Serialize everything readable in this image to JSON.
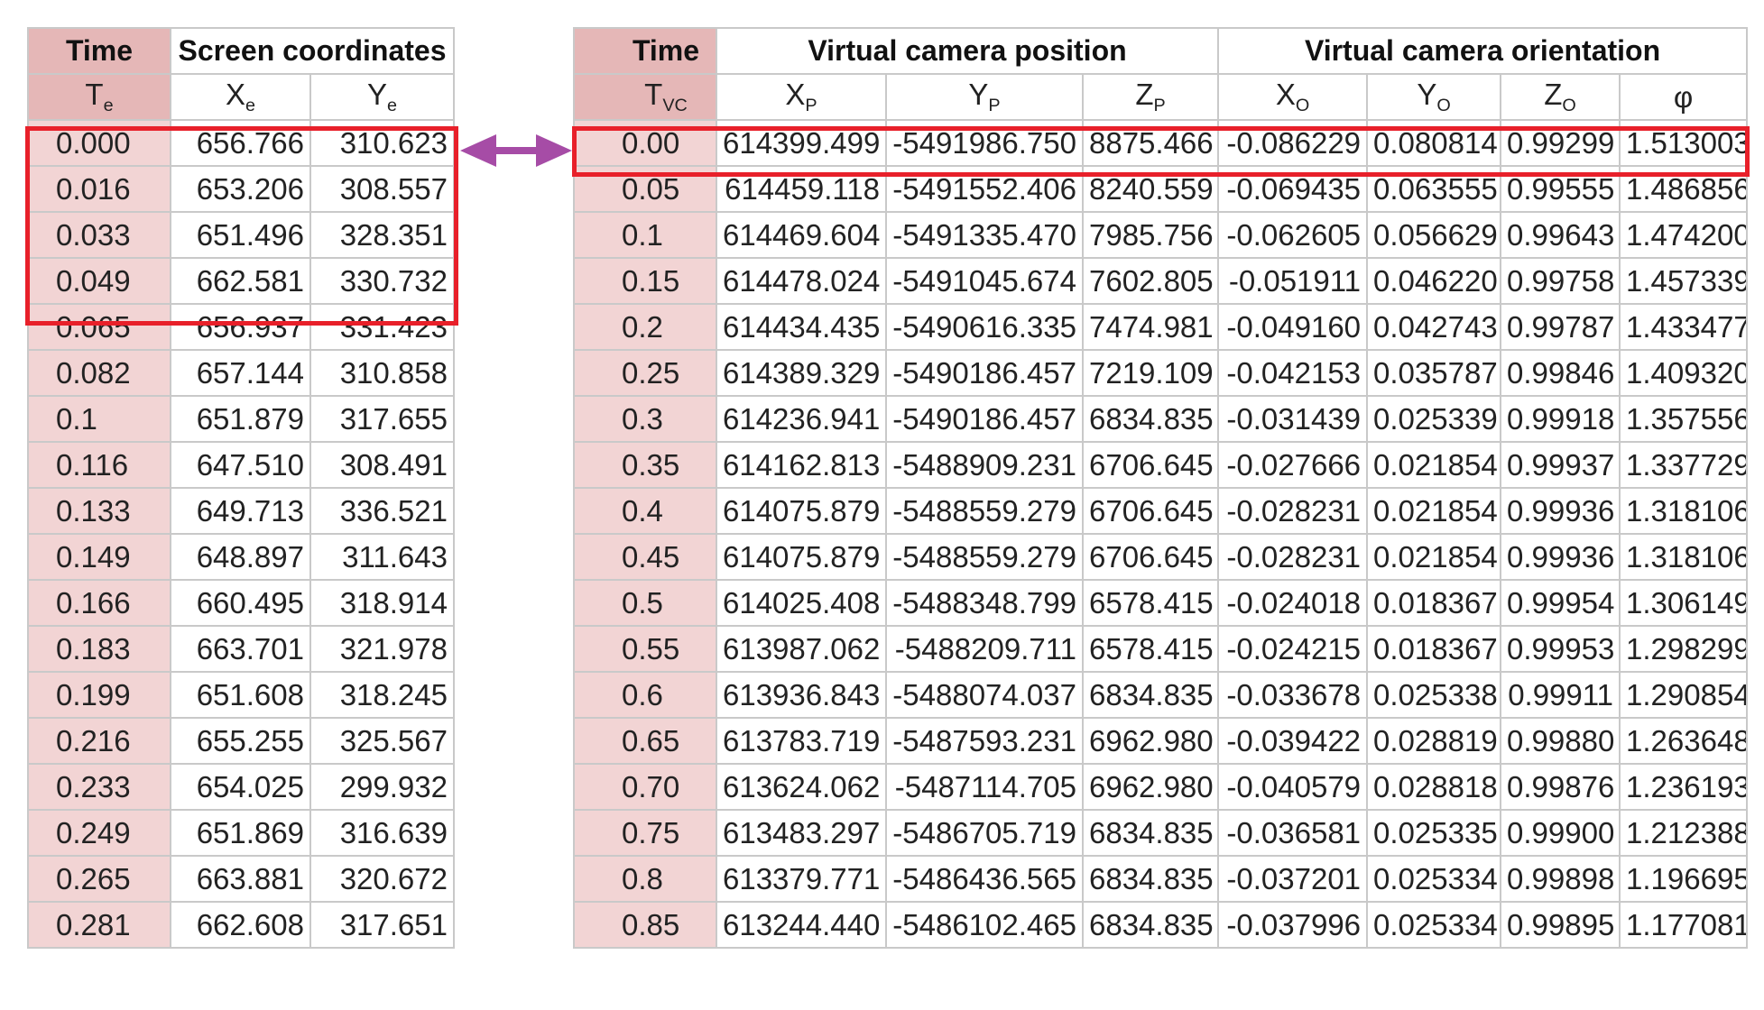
{
  "screen_table": {
    "time_header": "Time",
    "coords_header": "Screen coordinates",
    "time_symbol": "T",
    "time_symbol_sub": "e",
    "x_symbol": "X",
    "x_symbol_sub": "e",
    "y_symbol": "Y",
    "y_symbol_sub": "e",
    "rows": [
      [
        "0.000",
        "656.766",
        "310.623"
      ],
      [
        "0.016",
        "653.206",
        "308.557"
      ],
      [
        "0.033",
        "651.496",
        "328.351"
      ],
      [
        "0.049",
        "662.581",
        "330.732"
      ],
      [
        "0.065",
        "656.937",
        "331.423"
      ],
      [
        "0.082",
        "657.144",
        "310.858"
      ],
      [
        "0.1",
        "651.879",
        "317.655"
      ],
      [
        "0.116",
        "647.510",
        "308.491"
      ],
      [
        "0.133",
        "649.713",
        "336.521"
      ],
      [
        "0.149",
        "648.897",
        "311.643"
      ],
      [
        "0.166",
        "660.495",
        "318.914"
      ],
      [
        "0.183",
        "663.701",
        "321.978"
      ],
      [
        "0.199",
        "651.608",
        "318.245"
      ],
      [
        "0.216",
        "655.255",
        "325.567"
      ],
      [
        "0.233",
        "654.025",
        "299.932"
      ],
      [
        "0.249",
        "651.869",
        "316.639"
      ],
      [
        "0.265",
        "663.881",
        "320.672"
      ],
      [
        "0.281",
        "662.608",
        "317.651"
      ]
    ]
  },
  "camera_table": {
    "time_header": "Time",
    "position_header": "Virtual camera position",
    "orientation_header": "Virtual camera orientation",
    "time_symbol": "T",
    "time_symbol_sub": "VC",
    "xp_symbol": "X",
    "xp_sub": "P",
    "yp_symbol": "Y",
    "yp_sub": "P",
    "zp_symbol": "Z",
    "zp_sub": "P",
    "xo_symbol": "X",
    "xo_sub": "O",
    "yo_symbol": "Y",
    "yo_sub": "O",
    "zo_symbol": "Z",
    "zo_sub": "O",
    "phi_symbol": "φ",
    "rows": [
      [
        "0.00",
        "614399.499",
        "-5491986.750",
        "8875.466",
        "-0.086229",
        "0.080814",
        "0.99299",
        "1.513003"
      ],
      [
        "0.05",
        "614459.118",
        "-5491552.406",
        "8240.559",
        "-0.069435",
        "0.063555",
        "0.99555",
        "1.486856"
      ],
      [
        "0.1",
        "614469.604",
        "-5491335.470",
        "7985.756",
        "-0.062605",
        "0.056629",
        "0.99643",
        "1.474200"
      ],
      [
        "0.15",
        "614478.024",
        "-5491045.674",
        "7602.805",
        "-0.051911",
        "0.046220",
        "0.99758",
        "1.457339"
      ],
      [
        "0.2",
        "614434.435",
        "-5490616.335",
        "7474.981",
        "-0.049160",
        "0.042743",
        "0.99787",
        "1.433477"
      ],
      [
        "0.25",
        "614389.329",
        "-5490186.457",
        "7219.109",
        "-0.042153",
        "0.035787",
        "0.99846",
        "1.409320"
      ],
      [
        "0.3",
        "614236.941",
        "-5490186.457",
        "6834.835",
        "-0.031439",
        "0.025339",
        "0.99918",
        "1.357556"
      ],
      [
        "0.35",
        "614162.813",
        "-5488909.231",
        "6706.645",
        "-0.027666",
        "0.021854",
        "0.99937",
        "1.337729"
      ],
      [
        "0.4",
        "614075.879",
        "-5488559.279",
        "6706.645",
        "-0.028231",
        "0.021854",
        "0.99936",
        "1.318106"
      ],
      [
        "0.45",
        "614075.879",
        "-5488559.279",
        "6706.645",
        "-0.028231",
        "0.021854",
        "0.99936",
        "1.318106"
      ],
      [
        "0.5",
        "614025.408",
        "-5488348.799",
        "6578.415",
        "-0.024018",
        "0.018367",
        "0.99954",
        "1.306149"
      ],
      [
        "0.55",
        "613987.062",
        "-5488209.711",
        "6578.415",
        "-0.024215",
        "0.018367",
        "0.99953",
        "1.298299"
      ],
      [
        "0.6",
        "613936.843",
        "-5488074.037",
        "6834.835",
        "-0.033678",
        "0.025338",
        "0.99911",
        "1.290854"
      ],
      [
        "0.65",
        "613783.719",
        "-5487593.231",
        "6962.980",
        "-0.039422",
        "0.028819",
        "0.99880",
        "1.263648"
      ],
      [
        "0.70",
        "613624.062",
        "-5487114.705",
        "6962.980",
        "-0.040579",
        "0.028818",
        "0.99876",
        "1.236193"
      ],
      [
        "0.75",
        "613483.297",
        "-5486705.719",
        "6834.835",
        "-0.036581",
        "0.025335",
        "0.99900",
        "1.212388"
      ],
      [
        "0.8",
        "613379.771",
        "-5486436.565",
        "6834.835",
        "-0.037201",
        "0.025334",
        "0.99898",
        "1.196695"
      ],
      [
        "0.85",
        "613244.440",
        "-5486102.465",
        "6834.835",
        "-0.037996",
        "0.025334",
        "0.99895",
        "1.177081"
      ]
    ]
  },
  "colors": {
    "highlight": "#e8202a",
    "arrow": "#a64ca6",
    "time_header_fill": "#e5b7b7",
    "time_cell_fill": "#f2d4d4",
    "grid": "#c9c9c9"
  }
}
